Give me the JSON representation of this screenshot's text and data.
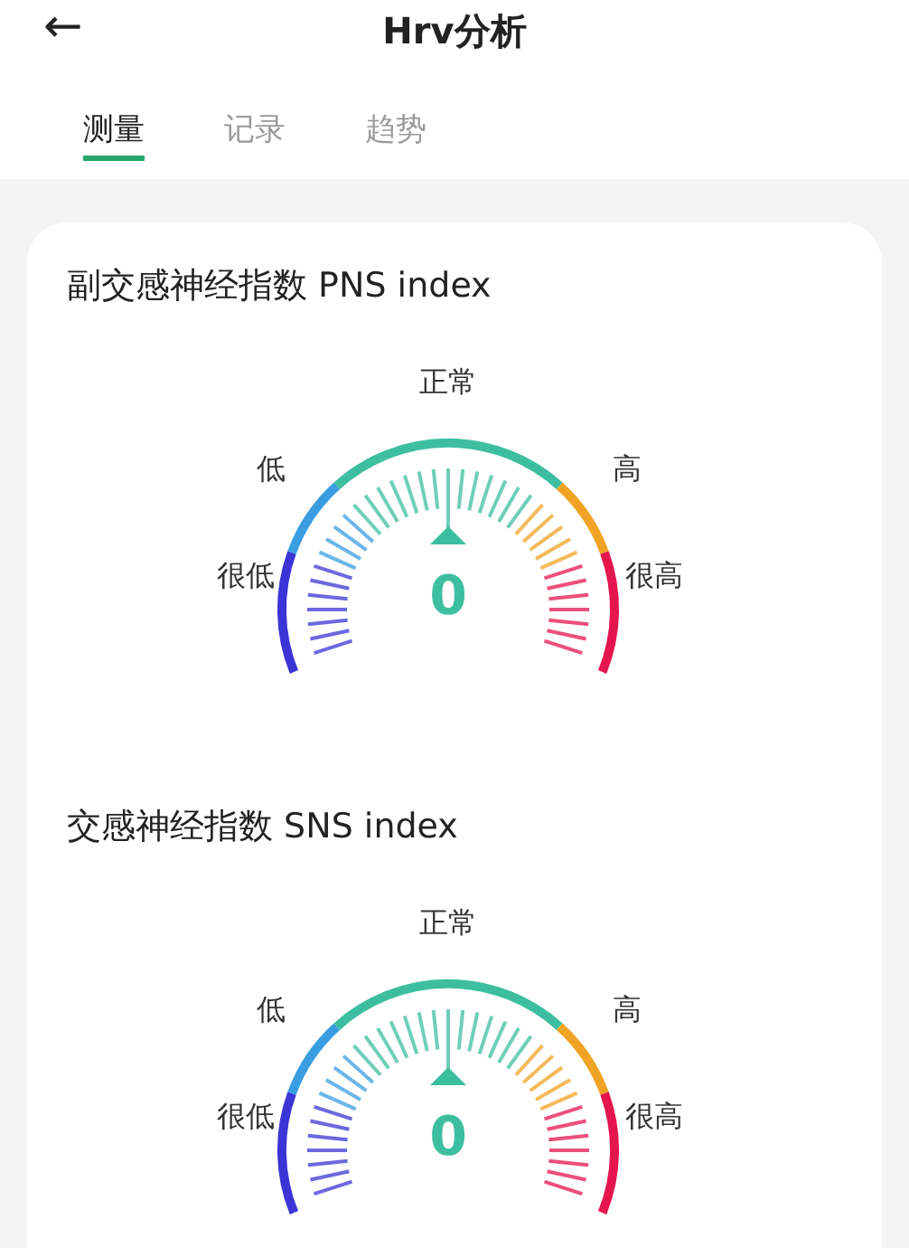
{
  "header": {
    "back": "←",
    "title": "Hrv分析"
  },
  "tabs": [
    {
      "label": "测量",
      "selected": true
    },
    {
      "label": "记录",
      "selected": false
    },
    {
      "label": "趋势",
      "selected": false
    }
  ],
  "sections": [
    {
      "title": "副交感神经指数 PNS index",
      "value": "0",
      "zones": [
        {
          "label": "很低",
          "color": "#3b35d6"
        },
        {
          "label": "低",
          "color": "#3a9de2"
        },
        {
          "label": "正常",
          "color": "#3dbf9f"
        },
        {
          "label": "高",
          "color": "#f0a324"
        },
        {
          "label": "很高",
          "color": "#e5164d"
        }
      ]
    },
    {
      "title": "交感神经指数 SNS index",
      "value": "0",
      "zones": [
        {
          "label": "很低",
          "color": "#3b35d6"
        },
        {
          "label": "低",
          "color": "#3a9de2"
        },
        {
          "label": "正常",
          "color": "#3dbf9f"
        },
        {
          "label": "高",
          "color": "#f0a324"
        },
        {
          "label": "很高",
          "color": "#e5164d"
        }
      ]
    }
  ]
}
